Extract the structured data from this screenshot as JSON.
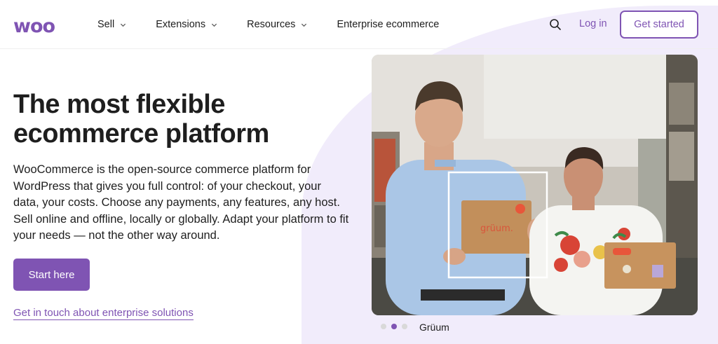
{
  "header": {
    "logo": "woo",
    "nav": [
      {
        "label": "Sell",
        "has_dropdown": true
      },
      {
        "label": "Extensions",
        "has_dropdown": true
      },
      {
        "label": "Resources",
        "has_dropdown": true
      },
      {
        "label": "Enterprise ecommerce",
        "has_dropdown": false
      }
    ],
    "search_icon": "search-icon",
    "login_label": "Log in",
    "get_started_label": "Get started"
  },
  "hero": {
    "title": "The most flexible ecommerce platform",
    "description": "WooCommerce is the open-source commerce platform for WordPress that gives you full control: of your checkout, your data, your costs. Choose any payments, any features, any host. Sell online and offline, locally or globally. Adapt your platform to fit your needs — not the other way around.",
    "start_label": "Start here",
    "enterprise_link": "Get in touch about enterprise solutions"
  },
  "carousel": {
    "box_brand": "grüum.",
    "caption": "Grüum",
    "slides": 3,
    "active_slide": 2
  },
  "colors": {
    "accent": "#7f54b3",
    "blob": "#f1ecfb",
    "text": "#1e1e1e"
  }
}
